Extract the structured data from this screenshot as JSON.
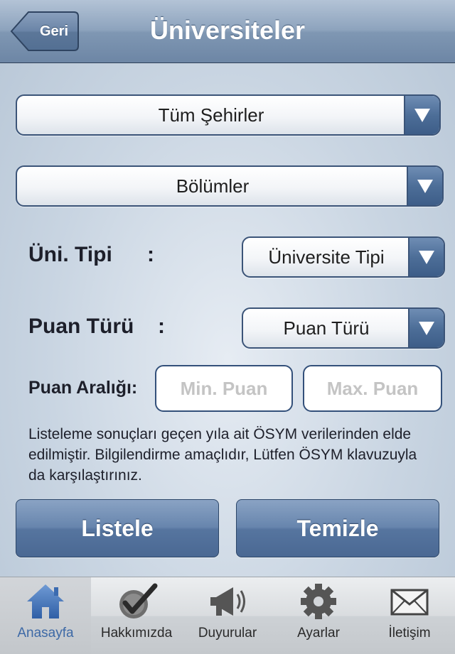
{
  "nav": {
    "back_label": "Geri",
    "title": "Üniversiteler"
  },
  "filters": {
    "city": "Tüm Şehirler",
    "department": "Bölümler",
    "uni_type_label": "Üni. Tipi",
    "uni_type_colon": ":",
    "uni_type_value": "Üniversite Tipi",
    "score_type_label": "Puan Türü",
    "score_type_colon": ":",
    "score_type_value": "Puan Türü",
    "score_range_label": "Puan Aralığı:",
    "min_placeholder": "Min. Puan",
    "max_placeholder": "Max. Puan"
  },
  "note": "Listeleme sonuçları geçen yıla ait ÖSYM verilerinden elde edilmiştir. Bilgilendirme amaçlıdır, Lütfen ÖSYM klavuzuyla da karşılaştırınız.",
  "buttons": {
    "list": "Listele",
    "clear": "Temizle"
  },
  "tabs": [
    {
      "label": "Anasayfa",
      "icon": "home-icon",
      "active": true
    },
    {
      "label": "Hakkımızda",
      "icon": "checkmark-icon",
      "active": false
    },
    {
      "label": "Duyurular",
      "icon": "megaphone-icon",
      "active": false
    },
    {
      "label": "Ayarlar",
      "icon": "gear-icon",
      "active": false
    },
    {
      "label": "İletişim",
      "icon": "envelope-icon",
      "active": false
    }
  ],
  "colors": {
    "accent": "#4a6893",
    "active_tab": "#3d69a6",
    "border": "#3b5478"
  }
}
